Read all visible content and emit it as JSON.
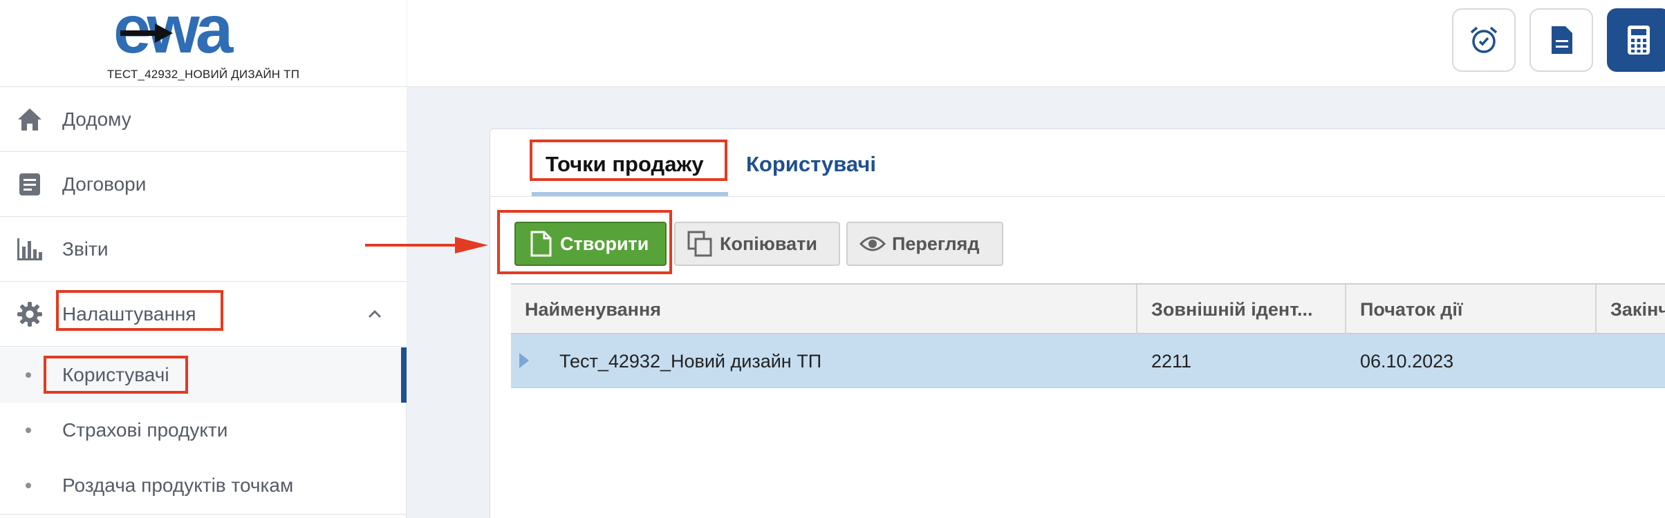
{
  "app": {
    "logo_text": "ewa",
    "org_name": "ТЕСТ_42932_НОВИЙ ДИЗАЙН ТП"
  },
  "sidebar": {
    "items": [
      {
        "label": "Додому",
        "icon": "home-icon"
      },
      {
        "label": "Договори",
        "icon": "document-list-icon"
      },
      {
        "label": "Звіти",
        "icon": "bar-chart-icon"
      },
      {
        "label": "Налаштування",
        "icon": "gear-icon",
        "expanded": true
      }
    ],
    "sub_items": [
      {
        "label": "Користувачі",
        "active": true
      },
      {
        "label": "Страхові продукти"
      },
      {
        "label": "Роздача продуктів точкам"
      }
    ]
  },
  "header": {
    "buttons": [
      {
        "icon": "alarm-clock-icon"
      },
      {
        "icon": "document-icon"
      },
      {
        "icon": "calculator-icon"
      }
    ]
  },
  "main": {
    "tabs": [
      {
        "label": "Точки продажу",
        "active": true
      },
      {
        "label": "Користувачі",
        "active": false
      }
    ],
    "toolbar": {
      "create_label": "Створити",
      "copy_label": "Копіювати",
      "view_label": "Перегляд"
    },
    "table": {
      "columns": [
        "Найменування",
        "Зовнішній ідент...",
        "Початок дії",
        "Закінч"
      ],
      "rows": [
        {
          "name": "Тест_42932_Новий дизайн ТП",
          "external_id": "2211",
          "start_date": "06.10.2023",
          "end_date": ""
        }
      ]
    }
  },
  "colors": {
    "brand_blue": "#1f4f8f",
    "create_green": "#58a339",
    "selected_row": "#c6ddf0",
    "annotation_red": "#e23b22"
  }
}
